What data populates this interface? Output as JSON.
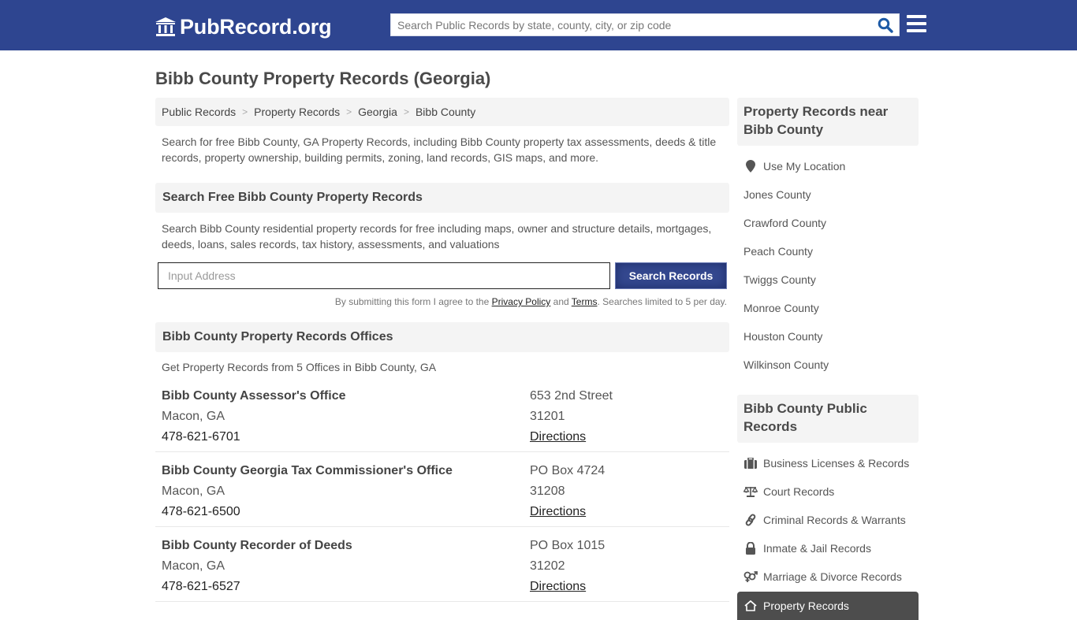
{
  "header": {
    "logo_text": "PubRecord.org",
    "search_placeholder": "Search Public Records by state, county, city, or zip code",
    "brand_color": "#2e4590"
  },
  "page": {
    "title": "Bibb County Property Records (Georgia)"
  },
  "breadcrumb": [
    {
      "label": "Public Records"
    },
    {
      "label": "Property Records"
    },
    {
      "label": "Georgia"
    },
    {
      "label": "Bibb County"
    }
  ],
  "breadcrumb_separator": ">",
  "intro": "Search for free Bibb County, GA Property Records, including Bibb County property tax assessments, deeds & title records, property ownership, building permits, zoning, land records, GIS maps, and more.",
  "search_section": {
    "heading": "Search Free Bibb County Property Records",
    "description": "Search Bibb County residential property records for free including maps, owner and structure details, mortgages, deeds, loans, sales records, tax history, assessments, and valuations",
    "input_placeholder": "Input Address",
    "button_label": "Search Records",
    "disclaimer_prefix": "By submitting this form I agree to the ",
    "privacy_link": "Privacy Policy",
    "disclaimer_and": " and ",
    "terms_link": "Terms",
    "disclaimer_suffix": ". Searches limited to 5 per day."
  },
  "offices_section": {
    "heading": "Bibb County Property Records Offices",
    "count_text": "Get Property Records from 5 Offices in Bibb County, GA",
    "offices": [
      {
        "name": "Bibb County Assessor's Office",
        "city": "Macon, GA",
        "phone": "478-621-6701",
        "address": "653 2nd Street",
        "zip": "31201",
        "directions": "Directions"
      },
      {
        "name": "Bibb County Georgia Tax Commissioner's Office",
        "city": "Macon, GA",
        "phone": "478-621-6500",
        "address": "PO Box 4724",
        "zip": "31208",
        "directions": "Directions"
      },
      {
        "name": "Bibb County Recorder of Deeds",
        "city": "Macon, GA",
        "phone": "478-621-6527",
        "address": "PO Box 1015",
        "zip": "31202",
        "directions": "Directions"
      }
    ]
  },
  "sidebar": {
    "nearby_heading": "Property Records near Bibb County",
    "use_location": {
      "label": "Use My Location",
      "icon": "map-marker-icon"
    },
    "nearby": [
      {
        "label": "Jones County"
      },
      {
        "label": "Crawford County"
      },
      {
        "label": "Peach County"
      },
      {
        "label": "Twiggs County"
      },
      {
        "label": "Monroe County"
      },
      {
        "label": "Houston County"
      },
      {
        "label": "Wilkinson County"
      }
    ],
    "public_heading": "Bibb County Public Records",
    "public_records": [
      {
        "label": "Business Licenses & Records",
        "icon": "briefcase-icon"
      },
      {
        "label": "Court Records",
        "icon": "scales-icon"
      },
      {
        "label": "Criminal Records & Warrants",
        "icon": "link-icon"
      },
      {
        "label": "Inmate & Jail Records",
        "icon": "lock-icon"
      },
      {
        "label": "Marriage & Divorce Records",
        "icon": "gender-icon"
      },
      {
        "label": "Property Records",
        "icon": "home-icon",
        "active": true
      }
    ]
  }
}
